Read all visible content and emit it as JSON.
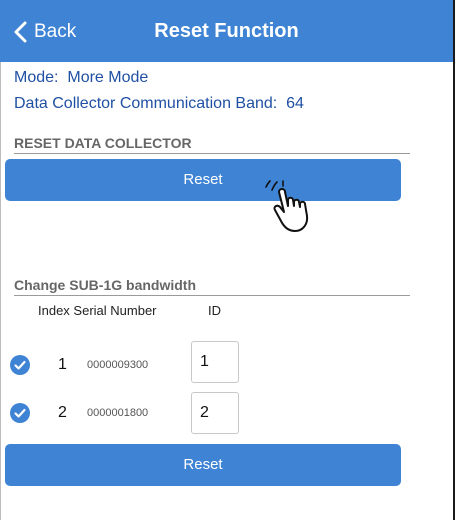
{
  "header": {
    "back_label": "Back",
    "title": "Reset Function"
  },
  "info": {
    "mode_label": "Mode:",
    "mode_value": "More Mode",
    "band_label": "Data Collector Communication Band:",
    "band_value": "64"
  },
  "reset_section": {
    "title": "RESET DATA COLLECTOR",
    "button_label": "Reset"
  },
  "bandwidth_section": {
    "title": "Change SUB-1G bandwidth",
    "col_index_serial": "Index Serial Number",
    "col_id": "ID",
    "rows": [
      {
        "checked": true,
        "index": "1",
        "serial": "0000009300",
        "id": "1"
      },
      {
        "checked": true,
        "index": "2",
        "serial": "0000001800",
        "id": "2"
      }
    ],
    "button_label": "Reset"
  },
  "icons": {
    "back": "chevron-left-icon",
    "check": "checkmark-circle-icon",
    "cursor": "pointing-hand-cursor-icon"
  },
  "colors": {
    "accent": "#3f84d4",
    "info_text": "#1f50a3",
    "section_text": "#666666"
  }
}
